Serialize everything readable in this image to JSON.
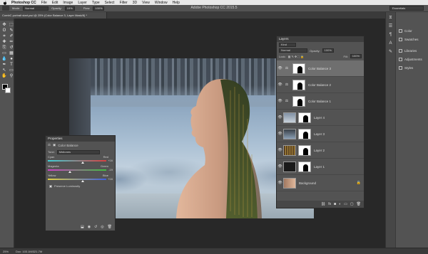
{
  "menubar": {
    "app_name": "Photoshop CC",
    "items": [
      "File",
      "Edit",
      "Image",
      "Layer",
      "Type",
      "Select",
      "Filter",
      "3D",
      "View",
      "Window",
      "Help"
    ]
  },
  "options_bar": {
    "mode_label": "Mode:",
    "mode_value": "Normal",
    "opacity_label": "Opacity:",
    "opacity_value": "19%",
    "flow_label": "Flow:",
    "flow_value": "100%",
    "app_title": "Adobe Photoshop CC 2015.5",
    "workspace": "Essentials"
  },
  "document": {
    "tab_title": "CombC portrait start.psd @ 25% (Color Balance 3, Layer Mask/8) *"
  },
  "tools": [
    "move",
    "marquee",
    "lasso",
    "quick-select",
    "crop",
    "eyedropper",
    "healing",
    "brush",
    "clone",
    "history",
    "eraser",
    "gradient",
    "blur",
    "dodge",
    "pen",
    "type",
    "path-select",
    "shape",
    "hand",
    "zoom"
  ],
  "tool_glyphs": [
    "✥",
    "⬚",
    "ʘ",
    "✎",
    "⌗",
    "✐",
    "✚",
    "✏",
    "⎘",
    "↺",
    "▭",
    "▦",
    "💧",
    "●",
    "✒",
    "T",
    "↖",
    "▭",
    "✋",
    "⚲"
  ],
  "dock": {
    "panels": [
      {
        "label": "Color"
      },
      {
        "label": "Swatches"
      },
      {
        "label": "Libraries"
      },
      {
        "label": "Adjustments"
      },
      {
        "label": "Styles"
      }
    ]
  },
  "layers_panel": {
    "title": "Layers",
    "kind": "Kind",
    "blend_mode": "Normal",
    "opacity_label": "Opacity:",
    "opacity_value": "100%",
    "lock_label": "Lock:",
    "fill_label": "Fill:",
    "fill_value": "100%",
    "layers": [
      {
        "name": "Color Balance 3",
        "type": "adjustment",
        "selected": true
      },
      {
        "name": "Color Balance 2",
        "type": "adjustment",
        "selected": false
      },
      {
        "name": "Color Balance 1",
        "type": "adjustment",
        "selected": false
      },
      {
        "name": "Layer 4",
        "type": "pixel",
        "selected": false
      },
      {
        "name": "Layer 3",
        "type": "pixel",
        "selected": false
      },
      {
        "name": "Layer 2",
        "type": "pixel",
        "selected": false
      },
      {
        "name": "Layer 1",
        "type": "pixel",
        "selected": false
      },
      {
        "name": "Background",
        "type": "background",
        "selected": false
      }
    ]
  },
  "properties_panel": {
    "title": "Properties",
    "adjustment": "Color Balance",
    "tone_label": "Tone:",
    "tone_value": "Midtones",
    "sliders": [
      {
        "left": "Cyan",
        "right": "Red",
        "value": "+16",
        "position": 0.6
      },
      {
        "left": "Magenta",
        "right": "Green",
        "value": "-19",
        "position": 0.38
      },
      {
        "left": "Yellow",
        "right": "Blue",
        "value": "+16",
        "position": 0.6
      }
    ],
    "preserve_luminosity": "Preserve Luminosity"
  },
  "status_bar": {
    "zoom": "25%",
    "doc": "Doc: 103.1M/321.7M"
  },
  "colors": {
    "ui_dark": "#535353",
    "selected_layer": "#6f6f6f"
  }
}
